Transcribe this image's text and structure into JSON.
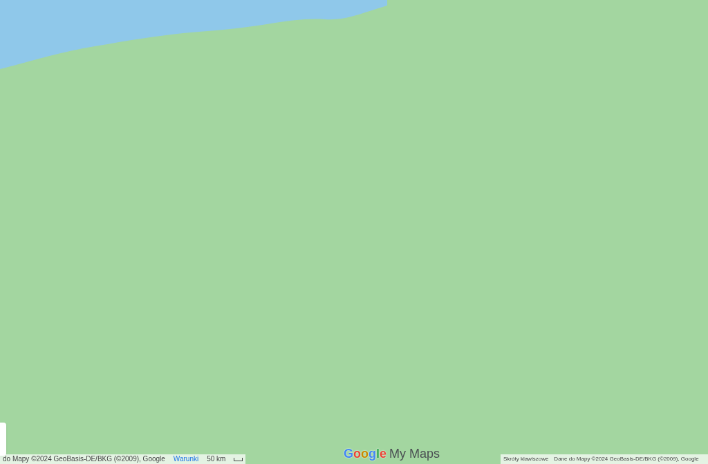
{
  "logo": {
    "brand": "Google",
    "product": "My Maps"
  },
  "attribution_left": {
    "data": "do Mapy ©2024 GeoBasis-DE/BKG (©2009), Google",
    "terms": "Warunki",
    "scale": "50 km"
  },
  "attribution_right": {
    "shortcuts": "Skróty klawiszowe",
    "data": "Dane do Mapy ©2024 GeoBasis-DE/BKG (©2009), Google"
  }
}
